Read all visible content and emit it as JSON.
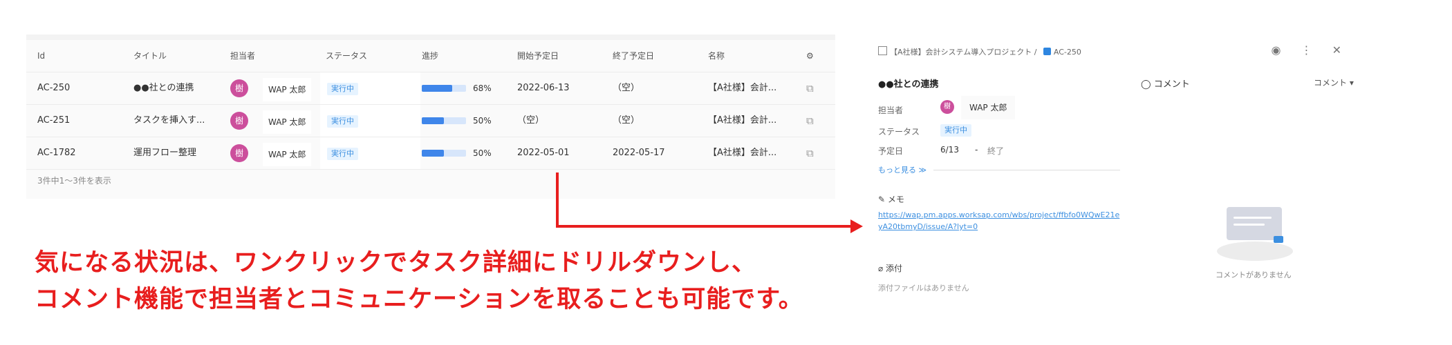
{
  "table": {
    "headers": {
      "id": "Id",
      "title": "タイトル",
      "assignee": "担当者",
      "status": "ステータス",
      "progress": "進捗",
      "start": "開始予定日",
      "end": "終了予定日",
      "name": "名称"
    },
    "rows": [
      {
        "id": "AC-250",
        "title": "●●社との連携",
        "avatar": "樹",
        "assignee": "WAP 太郎",
        "status": "実行中",
        "progress": 0.68,
        "progress_label": "68%",
        "start": "2022-06-13",
        "end": "（空）",
        "name": "【A社様】会計..."
      },
      {
        "id": "AC-251",
        "title": "タスクを挿入す...",
        "avatar": "樹",
        "assignee": "WAP 太郎",
        "status": "実行中",
        "progress": 0.5,
        "progress_label": "50%",
        "start": "（空）",
        "end": "（空）",
        "name": "【A社様】会計..."
      },
      {
        "id": "AC-1782",
        "title": "運用フロー整理",
        "avatar": "樹",
        "assignee": "WAP 太郎",
        "status": "実行中",
        "progress": 0.5,
        "progress_label": "50%",
        "start": "2022-05-01",
        "end": "2022-05-17",
        "name": "【A社様】会計..."
      }
    ],
    "count_text": "3件中1～3件を表示"
  },
  "caption": {
    "line1": "気になる状況は、ワンクリックでタスク詳細にドリルダウンし、",
    "line2": "コメント機能で担当者とコミュニケーションを取ることも可能です。"
  },
  "detail": {
    "breadcrumb_project": "【A社様】会計システム導入プロジェクト /",
    "breadcrumb_task": "AC-250",
    "task_title": "●●社との連携",
    "assignee_label": "担当者",
    "avatar": "樹",
    "assignee": "WAP 太郎",
    "status_label": "ステータス",
    "status": "実行中",
    "date_label": "予定日",
    "date_start": "6/13",
    "date_sep": "-",
    "date_end": "終了",
    "more": "もっと見る ≫",
    "memo_label": "メモ",
    "memo_link": "https://wap.pm.apps.worksap.com/wbs/project/ffbfo0WQwE21eyA20tbmyD/issue/A?lyt=0",
    "attach_label": "添付",
    "attach_empty": "添付ファイルはありません",
    "comment_header": "コメント",
    "comment_dropdown": "コメント ▾",
    "comment_empty": "コメントがありません"
  },
  "colors": {
    "accent": "#3c8fe0",
    "avatar": "#cc4f9c",
    "arrow": "#e81e1e"
  }
}
